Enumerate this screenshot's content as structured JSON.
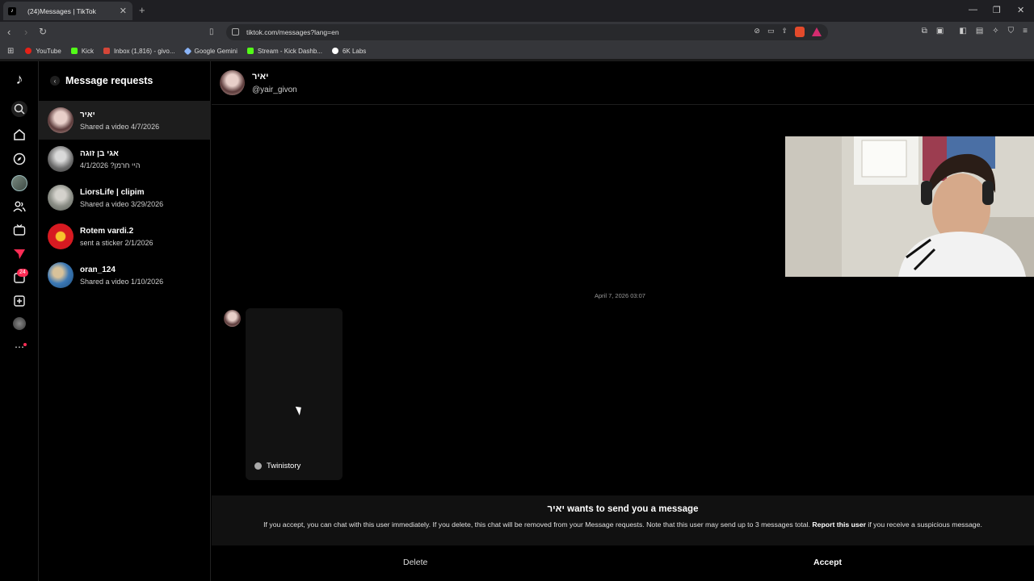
{
  "browser": {
    "tab_title": "(24)Messages | TikTok",
    "url": "tiktok.com/messages?lang=en",
    "bookmarks": [
      {
        "label": "YouTube",
        "color": "#e62117"
      },
      {
        "label": "Kick",
        "color": "#53fc18"
      },
      {
        "label": "Inbox (1,816) - givo...",
        "color": "#d44638"
      },
      {
        "label": "Google Gemini",
        "color": "#8ab4f8"
      },
      {
        "label": "Stream - Kick Dashb...",
        "color": "#53fc18"
      },
      {
        "label": "6K Labs",
        "color": "#ffffff"
      }
    ]
  },
  "rail": {
    "inbox_badge": "24"
  },
  "sidebar": {
    "title": "Message requests",
    "conversations": [
      {
        "name": "יאיר",
        "preview": "Shared a video 4/7/2026",
        "selected": true
      },
      {
        "name": "אגי בן זוגה",
        "preview": "היי חרמן? 4/1/2026"
      },
      {
        "name": "LiorsLife | clipim",
        "preview": "Shared a video 3/29/2026"
      },
      {
        "name": "Rotem vardi.2",
        "preview": "sent a sticker 2/1/2026"
      },
      {
        "name": "oran_124",
        "preview": "Shared a video 1/10/2026"
      }
    ]
  },
  "chat": {
    "name": "יאיר",
    "handle": "@yair_givon",
    "timestamp": "April 7, 2026 03:07",
    "video_author": "Twinistory"
  },
  "request": {
    "title_name": "יאיר",
    "title_suffix": " wants to send you a message",
    "body_1": "If you accept, you can chat with this user immediately. If you delete, this chat will be removed from your Message requests. Note that this user may send up to 3 messages total. ",
    "body_link": "Report this user",
    "body_2": " if you receive a suspicious message.",
    "delete_label": "Delete",
    "accept_label": "Accept"
  },
  "colors": {
    "accent": "#fe2c55",
    "background": "#000000",
    "selected_row": "#1d1d1d"
  }
}
